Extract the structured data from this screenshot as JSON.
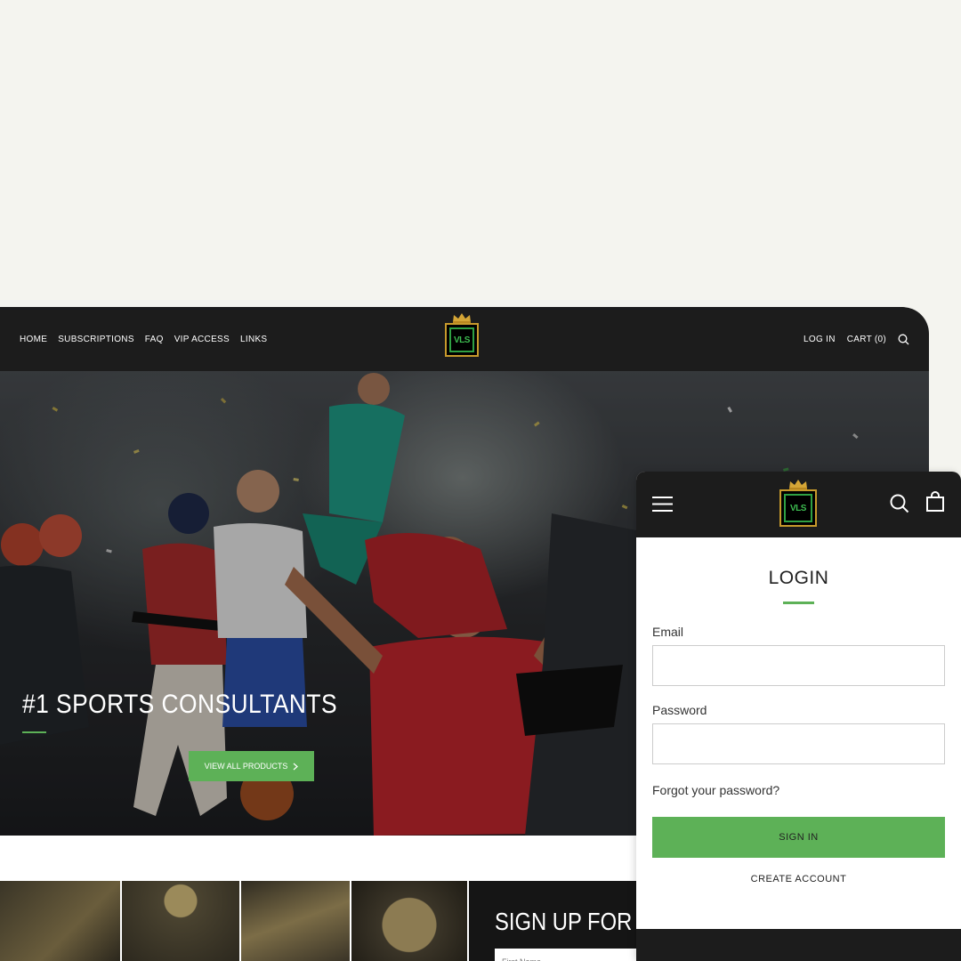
{
  "desktop": {
    "nav": {
      "links": [
        "HOME",
        "SUBSCRIPTIONS",
        "FAQ",
        "VIP ACCESS",
        "LINKS"
      ],
      "login": "LOG IN",
      "cart": "CART (0)"
    },
    "logo_text": "VLS",
    "hero": {
      "title": "#1 SPORTS CONSULTANTS",
      "button": "VIEW ALL PRODUCTS"
    },
    "signup": {
      "title": "SIGN UP FOR FRE",
      "first_name_placeholder": "First Name"
    }
  },
  "mobile": {
    "logo_text": "VLS",
    "login": {
      "title": "LOGIN",
      "email_label": "Email",
      "password_label": "Password",
      "forgot": "Forgot your password?",
      "sign_in": "SIGN IN",
      "create_account": "CREATE ACCOUNT"
    }
  },
  "colors": {
    "accent_green": "#5db157",
    "nav_dark": "#1c1c1c",
    "page_bg": "#f4f4ef",
    "logo_gold": "#c79a2c"
  }
}
